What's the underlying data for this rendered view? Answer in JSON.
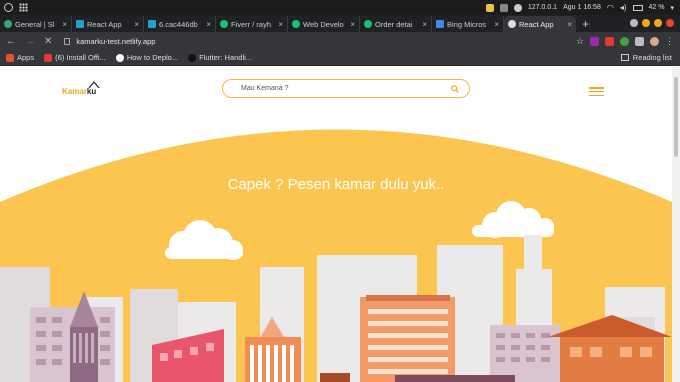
{
  "os": {
    "tray_time": "127.0.0.1",
    "date": "Agu 1  16:58",
    "battery": "42 %"
  },
  "tabs": [
    {
      "label": "General | Sl",
      "color": "#3aa57a",
      "active": false
    },
    {
      "label": "React App",
      "color": "#24a0c9",
      "active": false
    },
    {
      "label": "6.cac446db",
      "color": "#24a0c9",
      "active": false
    },
    {
      "label": "Fiverr / rayh",
      "color": "#1dbf73",
      "active": false
    },
    {
      "label": "Web Develo",
      "color": "#1dbf73",
      "active": false
    },
    {
      "label": "Order detai",
      "color": "#1dbf73",
      "active": false
    },
    {
      "label": "Bing Micros",
      "color": "#3c8ae6",
      "active": false
    },
    {
      "label": "React App",
      "color": "#dddddd",
      "active": true
    }
  ],
  "address": {
    "url": "kamarku-test.netlify.app"
  },
  "bookmarks": [
    {
      "label": "Apps",
      "color": "#e74c3c"
    },
    {
      "label": "(6) Install Offi...",
      "color": "#e53935"
    },
    {
      "label": "How to Deplo...",
      "color": "#444444"
    },
    {
      "label": "Flutter: Handli...",
      "color": "#222222"
    }
  ],
  "reading_list": "Reading list",
  "site": {
    "logo_a": "Kamar",
    "logo_b": "ku",
    "search_placeholder": "Mau Kemana ?",
    "headline": "Capek ? Pesen kamar dulu yuk..",
    "accent": "#f0a528",
    "hero_color": "#fcc54f"
  }
}
